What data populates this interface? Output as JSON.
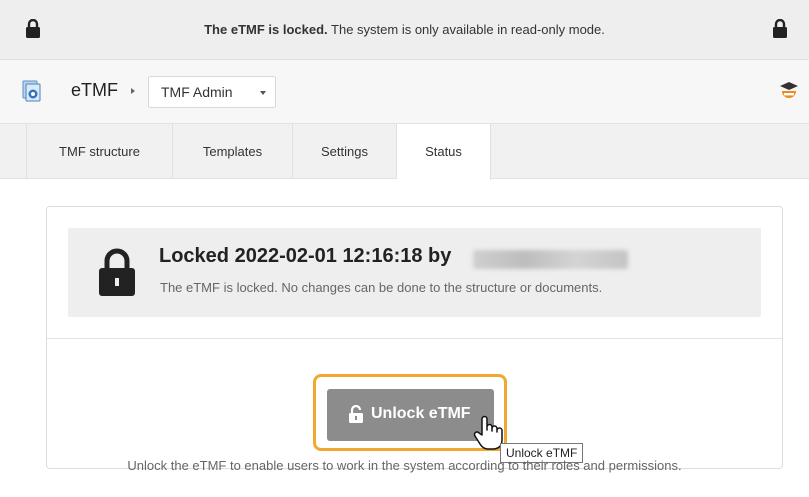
{
  "banner": {
    "bold_text": "The eTMF is locked.",
    "text": " The system is only available in read-only mode."
  },
  "app": {
    "name": "eTMF",
    "module": "TMF Admin"
  },
  "tabs": [
    {
      "label": "TMF structure"
    },
    {
      "label": "Templates"
    },
    {
      "label": "Settings"
    },
    {
      "label": "Status"
    }
  ],
  "active_tab": "Status",
  "status": {
    "title": "Locked 2022-02-01 12:16:18 by",
    "description": "The eTMF is locked. No changes can be done to the structure or documents."
  },
  "unlock": {
    "button_label": "Unlock eTMF",
    "tooltip": "Unlock eTMF",
    "help_text": "Unlock the eTMF to enable users to work in the system according to their roles and permissions."
  },
  "icons": {
    "banner_left": "lock-icon",
    "banner_right": "lock-icon",
    "app": "etmf-app-icon",
    "help": "graduation-cap-icon",
    "status": "lock-icon",
    "unlock_button": "unlock-icon",
    "cursor": "hand-pointer-icon"
  },
  "colors": {
    "highlight": "#f0a830",
    "button": "#8c8c8c"
  }
}
